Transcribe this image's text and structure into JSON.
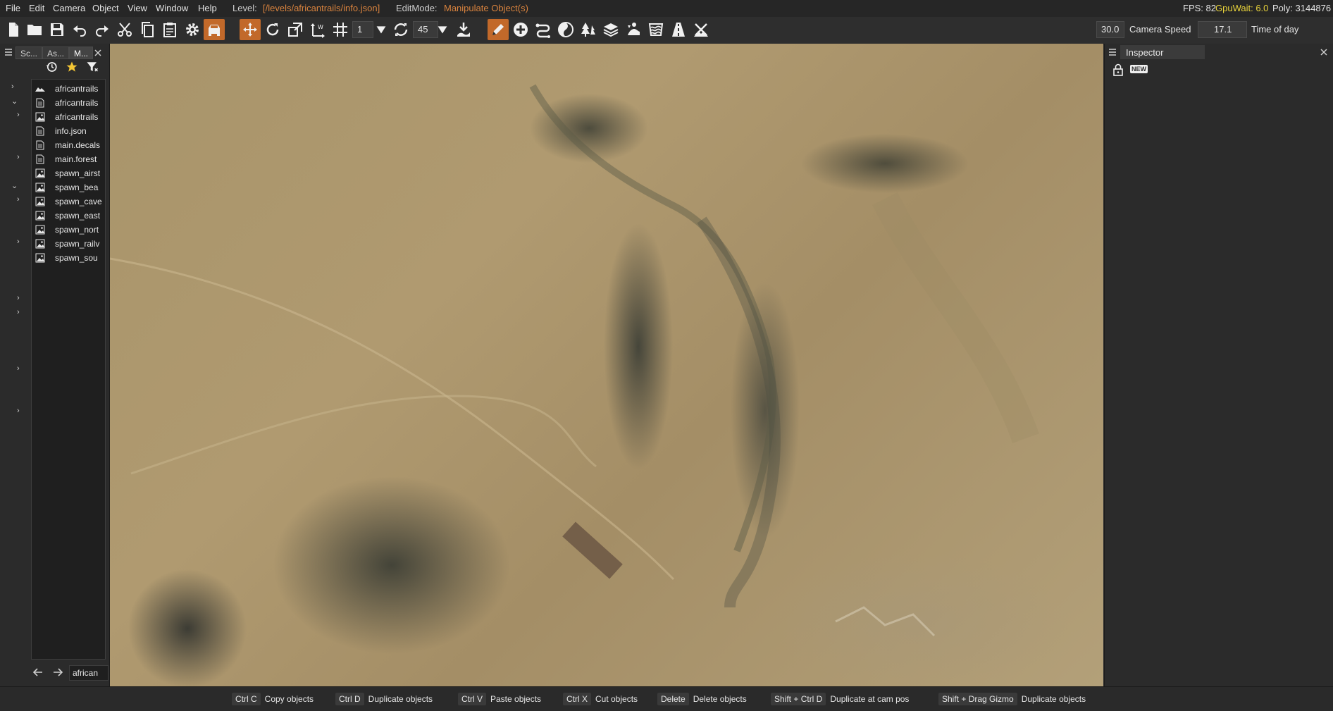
{
  "menu": {
    "items": [
      "File",
      "Edit",
      "Camera",
      "Object",
      "View",
      "Window",
      "Help"
    ],
    "level_label": "Level:",
    "level_value": "[/levels/africantrails/info.json]",
    "editmode_label": "EditMode:",
    "editmode_value": "Manipulate Object(s)",
    "fps": "FPS: 82",
    "gpuwait": "GpuWait: 6.0",
    "poly": "Poly: 3144876"
  },
  "toolbar": {
    "grid_value": "1",
    "rotate_snap_value": "45",
    "camera_speed_value": "30.0",
    "camera_speed_label": "Camera Speed",
    "time_of_day_value": "17.1",
    "time_of_day_label": "Time of day"
  },
  "left_panel": {
    "tabs": [
      "Sc...",
      "As...",
      "M..."
    ],
    "files": [
      {
        "name": "africantrails",
        "icon": "terrain-icon"
      },
      {
        "name": "africantrails",
        "icon": "file-icon"
      },
      {
        "name": "africantrails",
        "icon": "image-icon"
      },
      {
        "name": "info.json",
        "icon": "file-icon"
      },
      {
        "name": "main.decals",
        "icon": "file-icon"
      },
      {
        "name": "main.forest",
        "icon": "file-icon"
      },
      {
        "name": "spawn_airst",
        "icon": "image-icon"
      },
      {
        "name": "spawn_bea",
        "icon": "image-icon"
      },
      {
        "name": "spawn_cave",
        "icon": "image-icon"
      },
      {
        "name": "spawn_east",
        "icon": "image-icon"
      },
      {
        "name": "spawn_nort",
        "icon": "image-icon"
      },
      {
        "name": "spawn_railv",
        "icon": "image-icon"
      },
      {
        "name": "spawn_sou",
        "icon": "image-icon"
      }
    ],
    "path_value": "african"
  },
  "inspector": {
    "title": "Inspector",
    "new_badge": "NEW"
  },
  "status_bar": {
    "shortcuts": [
      {
        "key": "Ctrl C",
        "desc": "Copy objects"
      },
      {
        "key": "Ctrl D",
        "desc": "Duplicate objects"
      },
      {
        "key": "Ctrl V",
        "desc": "Paste objects"
      },
      {
        "key": "Ctrl X",
        "desc": "Cut objects"
      },
      {
        "key": "Delete",
        "desc": "Delete objects"
      },
      {
        "key": "Shift + Ctrl D",
        "desc": "Duplicate at cam pos"
      },
      {
        "key": "Shift + Drag Gizmo",
        "desc": "Duplicate objects"
      }
    ]
  },
  "colors": {
    "accent": "#c2692a",
    "level_text": "#d9833e",
    "gpuwait_text": "#e8d33b"
  }
}
